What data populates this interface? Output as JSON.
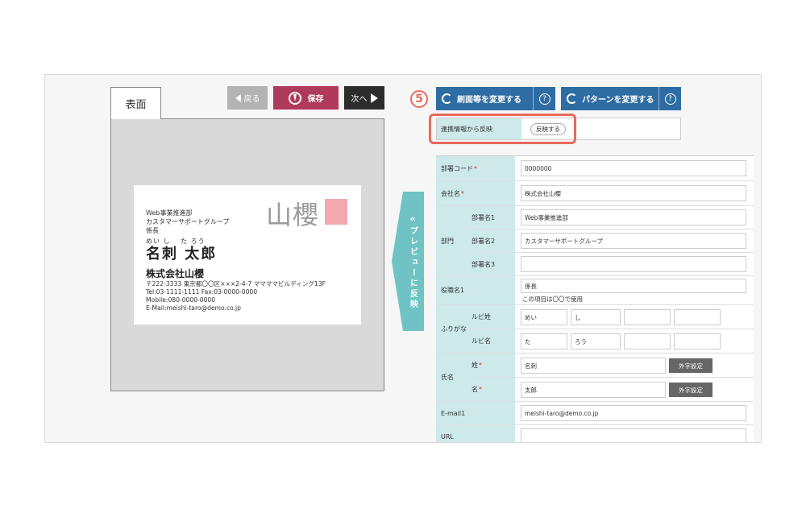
{
  "card_preview": {
    "tab_label": "表面",
    "logo_text": "山櫻",
    "dept1": "Web事業推進部",
    "dept2": "カスタマーサポートグループ",
    "title": "係長",
    "ruby": "めい し　 た ろう",
    "name": "名刺 太郎",
    "company": "株式会社山櫻",
    "address": "〒222-3333 東京都〇〇区×××2-4-7 ママママビルディング13F",
    "tel_fax": "Tel:03-1111-1111 Fax:03-0000-0000",
    "mobile": "Mobile:080-0000-0000",
    "email": "E-Mail:meishi-taro@demo.co.jp"
  },
  "toolbar": {
    "back_label": "戻る",
    "save_label": "保存",
    "next_label": "次へ"
  },
  "side_toggle": {
    "chevron": "«",
    "label": "プレビューに反映"
  },
  "top_buttons": {
    "change_layout": "刷面等を変更する",
    "change_pattern": "パターンを変更する",
    "help": "?"
  },
  "step_marker": "5",
  "reflect": {
    "label": "連携情報から反映",
    "button": "反映する"
  },
  "form": {
    "dept_code": {
      "label": "部署コード",
      "value": "0000000"
    },
    "company": {
      "label": "会社名",
      "value": "株式会社山櫻"
    },
    "dept": {
      "label": "部門",
      "name1_label": "部署名1",
      "name1_value": "Web事業推進部",
      "name2_label": "部署名2",
      "name2_value": "カスタマーサポートグループ",
      "name3_label": "部署名3",
      "name3_value": ""
    },
    "position": {
      "label": "役職名1",
      "value": "係長",
      "note": "この項目は〇〇で使用"
    },
    "furigana": {
      "label": "ふりがな",
      "sei_label": "ルビ姓",
      "sei_values": [
        "めい",
        "し",
        "",
        ""
      ],
      "mei_label": "ルビ名",
      "mei_values": [
        "た",
        "ろう",
        "",
        ""
      ]
    },
    "fullname": {
      "label": "氏名",
      "sei_label": "姓",
      "sei_value": "名刺",
      "mei_label": "名",
      "mei_value": "太郎",
      "ext_button": "外字設定"
    },
    "email": {
      "label": "E-mail1",
      "value": "meishi-taro@demo.co.jp"
    },
    "url": {
      "label": "URL",
      "value": ""
    },
    "required_mark": "*"
  },
  "colors": {
    "accent_blue": "#2e6da4",
    "save_red": "#b03a5b",
    "teal": "#6fc3c5",
    "label_bg": "#cde9ea",
    "highlight": "#e86a5c",
    "logo_pink": "#f4a8b0"
  }
}
